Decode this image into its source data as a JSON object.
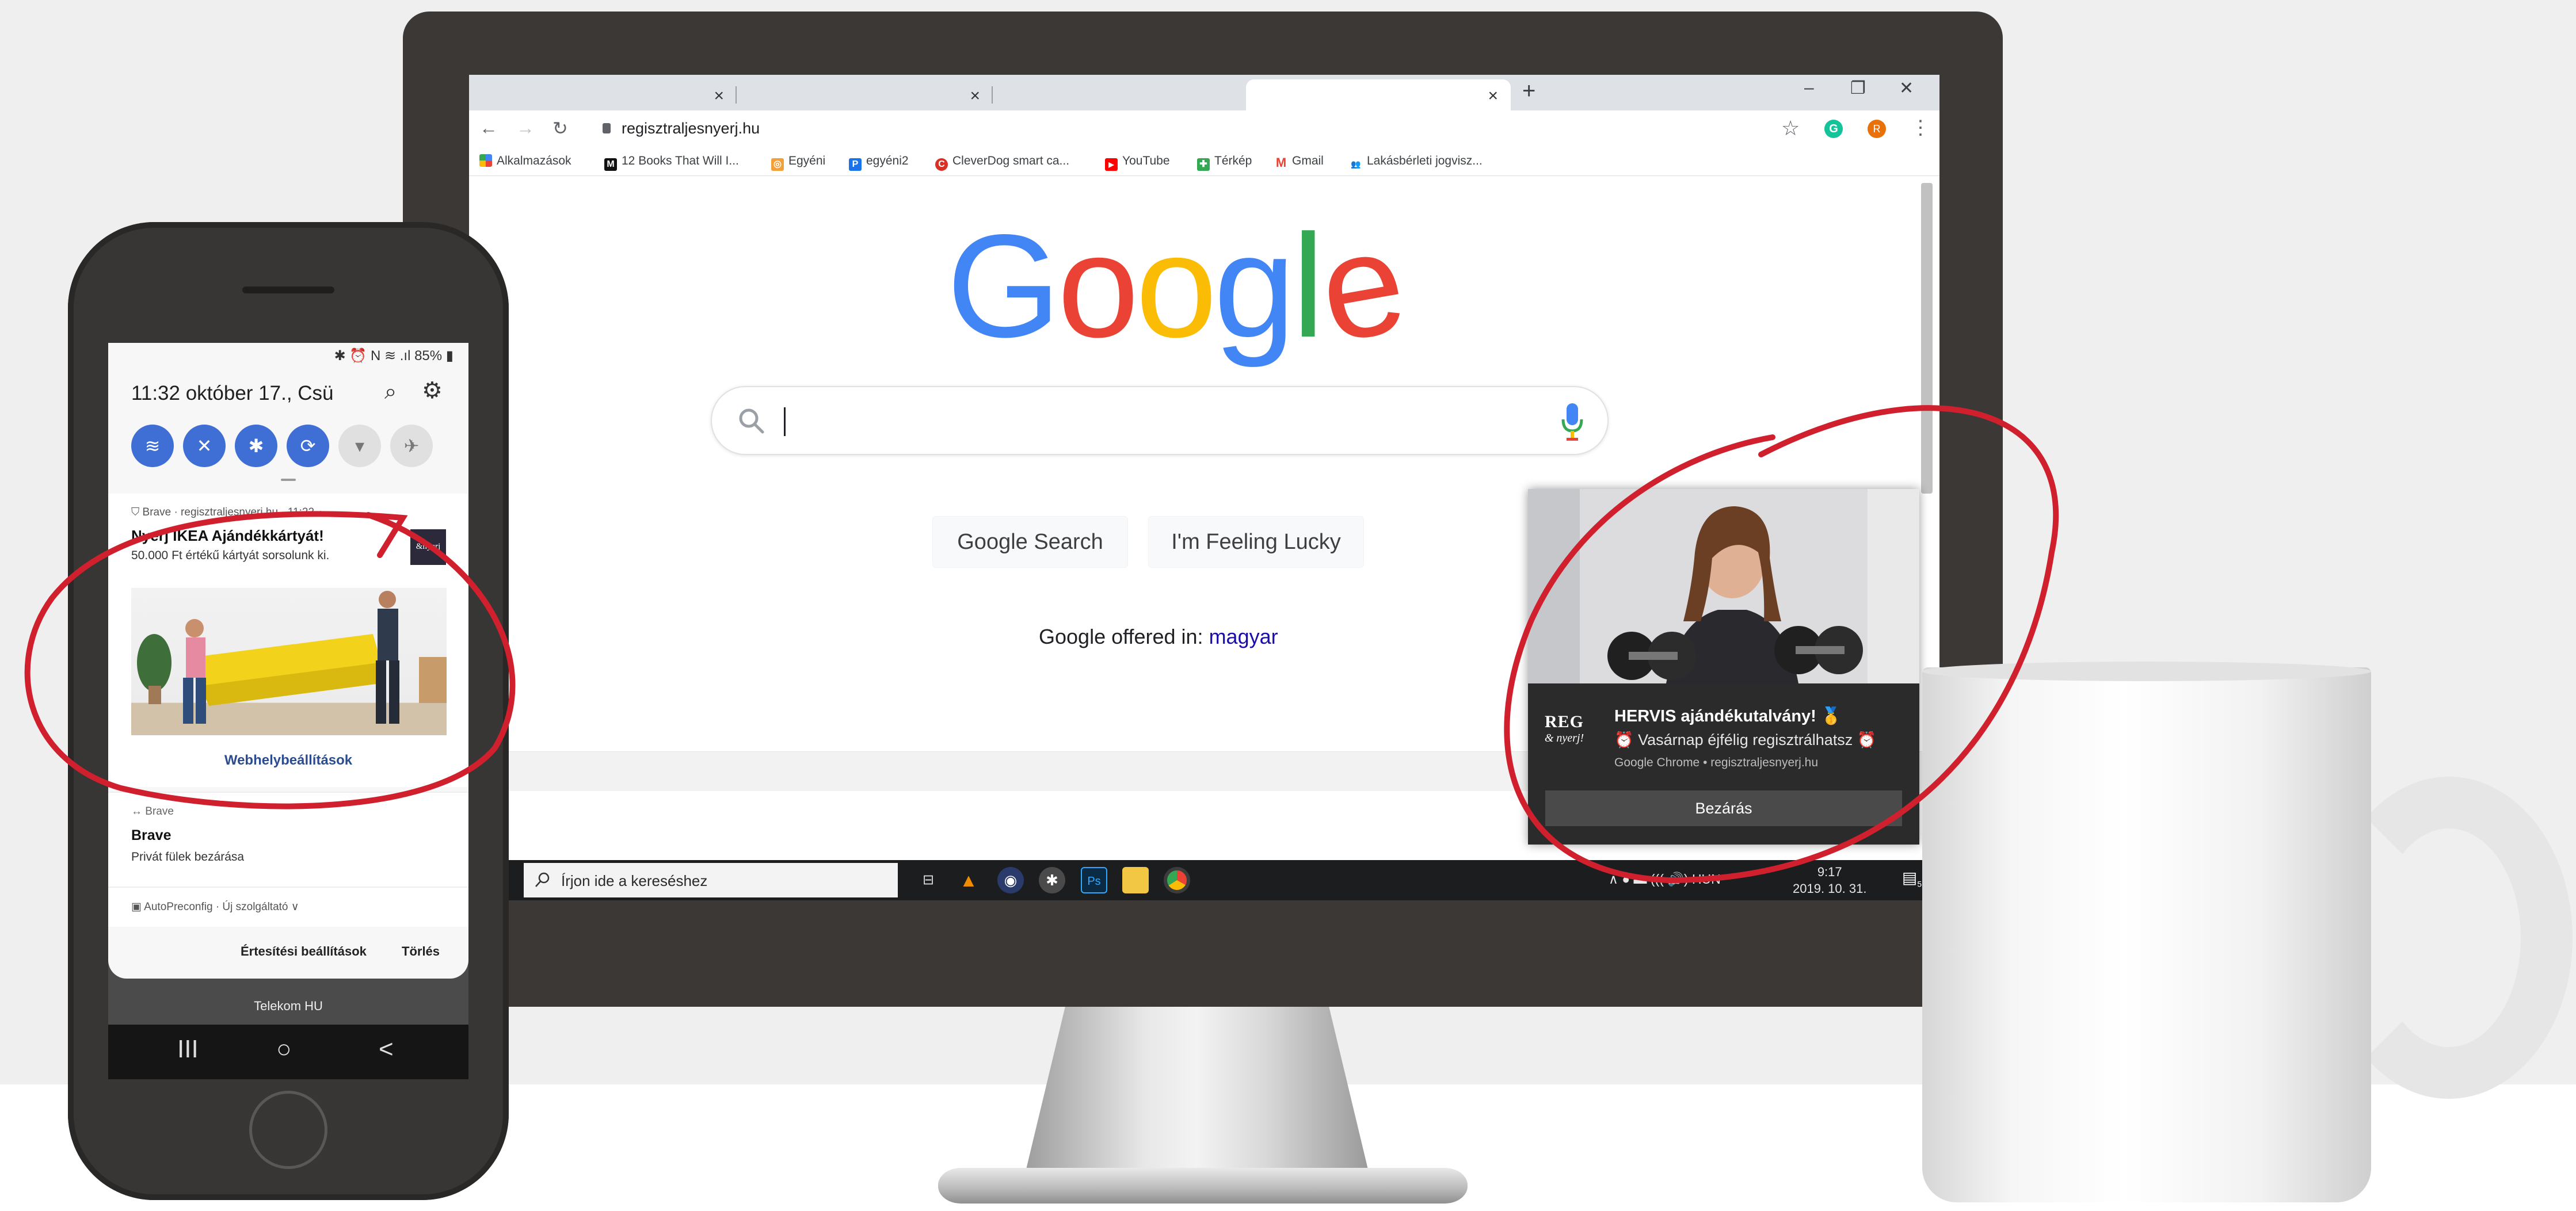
{
  "chrome": {
    "tabs": [
      {
        "close": "×"
      },
      {
        "close": "×"
      },
      {
        "close": "×"
      }
    ],
    "new_tab": "+",
    "window_controls": [
      "–",
      "❐",
      "✕"
    ],
    "url": "regisztraljesnyerj.hu",
    "profile_letter": "R",
    "extension_letter": "G",
    "bookmarks": [
      {
        "label": "Alkalmazások",
        "icon": "apps-grid-icon",
        "color": "#e94235"
      },
      {
        "label": "12 Books That Will I...",
        "icon": "medium-icon",
        "color": "#111111",
        "letter": "M"
      },
      {
        "label": "Egyéni",
        "icon": "globe-icon",
        "color": "#f4a03a",
        "letter": "◎"
      },
      {
        "label": "egyéni2",
        "icon": "p-icon",
        "color": "#1a73e8",
        "letter": "P"
      },
      {
        "label": "CleverDog smart ca...",
        "icon": "cleverdog-icon",
        "color": "#d93025",
        "letter": "C"
      },
      {
        "label": "YouTube",
        "icon": "youtube-icon",
        "color": "#ff0000",
        "letter": "▶"
      },
      {
        "label": "Térkép",
        "icon": "maps-icon",
        "color": "#34a853",
        "letter": "✚"
      },
      {
        "label": "Gmail",
        "icon": "gmail-icon",
        "color": "#ea4335",
        "letter": "M"
      },
      {
        "label": "Lakásbérleti jogvisz...",
        "icon": "people-icon",
        "color": "#fbbc05",
        "letter": "👥"
      }
    ]
  },
  "google": {
    "logo_letters": [
      {
        "ch": "G",
        "color": "#4285F4"
      },
      {
        "ch": "o",
        "color": "#EA4335"
      },
      {
        "ch": "o",
        "color": "#FBBC05"
      },
      {
        "ch": "g",
        "color": "#4285F4"
      },
      {
        "ch": "l",
        "color": "#34A853"
      },
      {
        "ch": "e",
        "color": "#EA4335"
      }
    ],
    "search_button": "Google Search",
    "lucky_button": "I'm Feeling Lucky",
    "offered_in": "Google offered in:",
    "language_link": "magyar"
  },
  "toast": {
    "title": "HERVIS ajándékutalvány! 🥇",
    "text": "⏰ Vasárnap éjfélig regisztrálhatsz ⏰",
    "source": "Google Chrome • regisztraljesnyerj.hu",
    "logo_line1": "REG",
    "logo_line2": "& nyerj!",
    "close_button": "Bezárás"
  },
  "taskbar": {
    "search_placeholder": "Írjon ide a kereséshez",
    "tray": "∧   ● ▬ ((( 🔊) HUN",
    "time": "9:17",
    "date": "2019. 10. 31.",
    "notification_count": "5"
  },
  "phone": {
    "status": "✱ ⏰ N ≋ .ıl 85% ▮",
    "datetime": "11:32  október 17., Csü",
    "notif1": {
      "app_line": "⛉ Brave · regisztraljesnyerj.hu · 11:22 ∧",
      "title": "Nyerj IKEA Ajándékkártyát!",
      "text": "50.000 Ft értékű kártyát sorsolunk ki.",
      "badge": "&nyerj",
      "link": "Webhelybeállítások"
    },
    "notif2": {
      "app_line": "↔ Brave",
      "title": "Brave",
      "text": "Privát fülek bezárása"
    },
    "notif3": {
      "text": "▣ AutoPreconfig · Új szolgáltató ∨"
    },
    "footer_settings": "Értesítési beállítások",
    "footer_clear": "Törlés",
    "carrier": "Telekom HU",
    "nav": [
      "III",
      "○",
      "<"
    ]
  },
  "colors": {
    "annotation_red": "#d0202e",
    "monitor_bezel": "#3b3836",
    "qs_active": "#3f6fd4"
  }
}
